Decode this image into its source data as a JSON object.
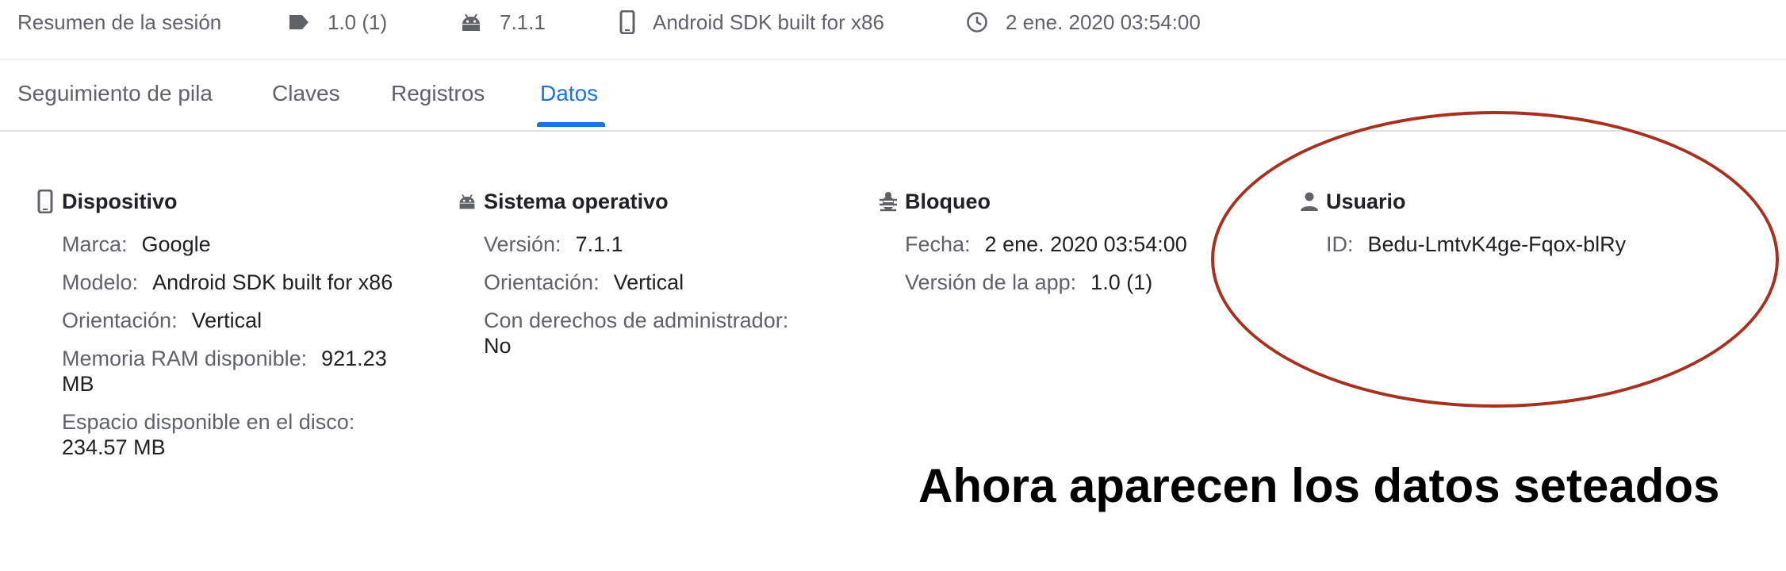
{
  "summary": {
    "title": "Resumen de la sesión",
    "version": "1.0 (1)",
    "os_version": "7.1.1",
    "device": "Android SDK built for x86",
    "datetime": "2 ene. 2020 03:54:00",
    "icons": [
      "tag-icon",
      "android-icon",
      "phone-icon",
      "clock-icon"
    ]
  },
  "tabs": [
    {
      "label": "Seguimiento de pila",
      "active": false
    },
    {
      "label": "Claves",
      "active": false
    },
    {
      "label": "Registros",
      "active": false
    },
    {
      "label": "Datos",
      "active": true
    }
  ],
  "sections": {
    "device": {
      "title": "Dispositivo",
      "brand_label": "Marca:",
      "brand": "Google",
      "model_label": "Modelo:",
      "model": "Android SDK built for x86",
      "orientation_label": "Orientación:",
      "orientation": "Vertical",
      "ram_label": "Memoria RAM disponible:",
      "ram_1": "921.23",
      "ram_2": "MB",
      "disk_label": "Espacio disponible en el disco:",
      "disk": "234.57 MB"
    },
    "os": {
      "title": "Sistema operativo",
      "version_label": "Versión:",
      "version": "7.1.1",
      "orientation_label": "Orientación:",
      "orientation": "Vertical",
      "root_label": "Con derechos de administrador:",
      "root": "No"
    },
    "crash": {
      "title": "Bloqueo",
      "date_label": "Fecha:",
      "date": "2 ene. 2020 03:54:00",
      "app_version_label": "Versión de la app:",
      "app_version": "1.0 (1)"
    },
    "user": {
      "title": "Usuario",
      "id_label": "ID:",
      "id": "Bedu-LmtvK4ge-Fqox-blRy"
    }
  },
  "annotation": {
    "caption": "Ahora aparecen los datos seteados",
    "color": "#a8301f"
  },
  "colors": {
    "accent": "#1a73e8",
    "muted": "#5f6368",
    "text": "#202124"
  }
}
